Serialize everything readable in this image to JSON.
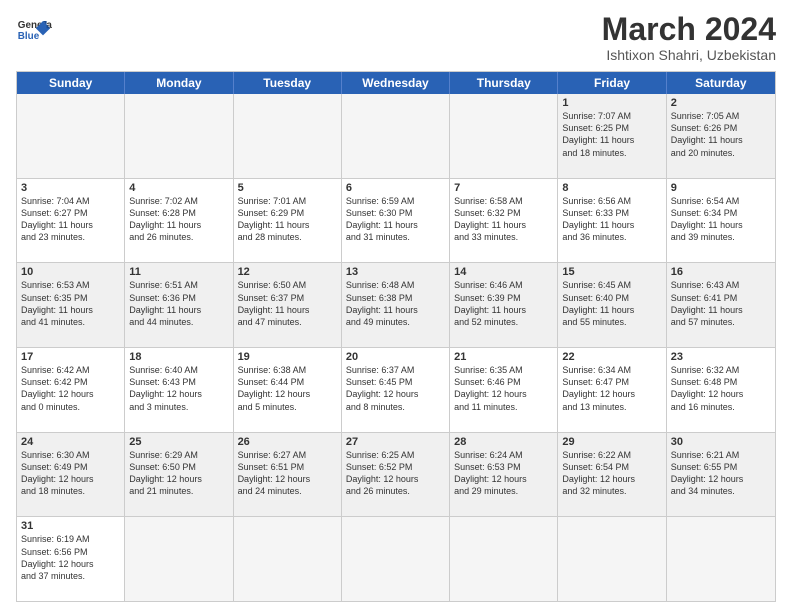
{
  "header": {
    "logo_general": "General",
    "logo_blue": "Blue",
    "month_title": "March 2024",
    "subtitle": "Ishtixon Shahri, Uzbekistan"
  },
  "weekdays": [
    "Sunday",
    "Monday",
    "Tuesday",
    "Wednesday",
    "Thursday",
    "Friday",
    "Saturday"
  ],
  "rows": [
    {
      "cells": [
        {
          "empty": true
        },
        {
          "empty": true
        },
        {
          "empty": true
        },
        {
          "empty": true
        },
        {
          "empty": true
        },
        {
          "day": "1",
          "lines": [
            "Sunrise: 7:07 AM",
            "Sunset: 6:25 PM",
            "Daylight: 11 hours",
            "and 18 minutes."
          ]
        },
        {
          "day": "2",
          "lines": [
            "Sunrise: 7:05 AM",
            "Sunset: 6:26 PM",
            "Daylight: 11 hours",
            "and 20 minutes."
          ]
        }
      ]
    },
    {
      "cells": [
        {
          "day": "3",
          "lines": [
            "Sunrise: 7:04 AM",
            "Sunset: 6:27 PM",
            "Daylight: 11 hours",
            "and 23 minutes."
          ]
        },
        {
          "day": "4",
          "lines": [
            "Sunrise: 7:02 AM",
            "Sunset: 6:28 PM",
            "Daylight: 11 hours",
            "and 26 minutes."
          ]
        },
        {
          "day": "5",
          "lines": [
            "Sunrise: 7:01 AM",
            "Sunset: 6:29 PM",
            "Daylight: 11 hours",
            "and 28 minutes."
          ]
        },
        {
          "day": "6",
          "lines": [
            "Sunrise: 6:59 AM",
            "Sunset: 6:30 PM",
            "Daylight: 11 hours",
            "and 31 minutes."
          ]
        },
        {
          "day": "7",
          "lines": [
            "Sunrise: 6:58 AM",
            "Sunset: 6:32 PM",
            "Daylight: 11 hours",
            "and 33 minutes."
          ]
        },
        {
          "day": "8",
          "lines": [
            "Sunrise: 6:56 AM",
            "Sunset: 6:33 PM",
            "Daylight: 11 hours",
            "and 36 minutes."
          ]
        },
        {
          "day": "9",
          "lines": [
            "Sunrise: 6:54 AM",
            "Sunset: 6:34 PM",
            "Daylight: 11 hours",
            "and 39 minutes."
          ]
        }
      ]
    },
    {
      "cells": [
        {
          "day": "10",
          "lines": [
            "Sunrise: 6:53 AM",
            "Sunset: 6:35 PM",
            "Daylight: 11 hours",
            "and 41 minutes."
          ]
        },
        {
          "day": "11",
          "lines": [
            "Sunrise: 6:51 AM",
            "Sunset: 6:36 PM",
            "Daylight: 11 hours",
            "and 44 minutes."
          ]
        },
        {
          "day": "12",
          "lines": [
            "Sunrise: 6:50 AM",
            "Sunset: 6:37 PM",
            "Daylight: 11 hours",
            "and 47 minutes."
          ]
        },
        {
          "day": "13",
          "lines": [
            "Sunrise: 6:48 AM",
            "Sunset: 6:38 PM",
            "Daylight: 11 hours",
            "and 49 minutes."
          ]
        },
        {
          "day": "14",
          "lines": [
            "Sunrise: 6:46 AM",
            "Sunset: 6:39 PM",
            "Daylight: 11 hours",
            "and 52 minutes."
          ]
        },
        {
          "day": "15",
          "lines": [
            "Sunrise: 6:45 AM",
            "Sunset: 6:40 PM",
            "Daylight: 11 hours",
            "and 55 minutes."
          ]
        },
        {
          "day": "16",
          "lines": [
            "Sunrise: 6:43 AM",
            "Sunset: 6:41 PM",
            "Daylight: 11 hours",
            "and 57 minutes."
          ]
        }
      ]
    },
    {
      "cells": [
        {
          "day": "17",
          "lines": [
            "Sunrise: 6:42 AM",
            "Sunset: 6:42 PM",
            "Daylight: 12 hours",
            "and 0 minutes."
          ]
        },
        {
          "day": "18",
          "lines": [
            "Sunrise: 6:40 AM",
            "Sunset: 6:43 PM",
            "Daylight: 12 hours",
            "and 3 minutes."
          ]
        },
        {
          "day": "19",
          "lines": [
            "Sunrise: 6:38 AM",
            "Sunset: 6:44 PM",
            "Daylight: 12 hours",
            "and 5 minutes."
          ]
        },
        {
          "day": "20",
          "lines": [
            "Sunrise: 6:37 AM",
            "Sunset: 6:45 PM",
            "Daylight: 12 hours",
            "and 8 minutes."
          ]
        },
        {
          "day": "21",
          "lines": [
            "Sunrise: 6:35 AM",
            "Sunset: 6:46 PM",
            "Daylight: 12 hours",
            "and 11 minutes."
          ]
        },
        {
          "day": "22",
          "lines": [
            "Sunrise: 6:34 AM",
            "Sunset: 6:47 PM",
            "Daylight: 12 hours",
            "and 13 minutes."
          ]
        },
        {
          "day": "23",
          "lines": [
            "Sunrise: 6:32 AM",
            "Sunset: 6:48 PM",
            "Daylight: 12 hours",
            "and 16 minutes."
          ]
        }
      ]
    },
    {
      "cells": [
        {
          "day": "24",
          "lines": [
            "Sunrise: 6:30 AM",
            "Sunset: 6:49 PM",
            "Daylight: 12 hours",
            "and 18 minutes."
          ]
        },
        {
          "day": "25",
          "lines": [
            "Sunrise: 6:29 AM",
            "Sunset: 6:50 PM",
            "Daylight: 12 hours",
            "and 21 minutes."
          ]
        },
        {
          "day": "26",
          "lines": [
            "Sunrise: 6:27 AM",
            "Sunset: 6:51 PM",
            "Daylight: 12 hours",
            "and 24 minutes."
          ]
        },
        {
          "day": "27",
          "lines": [
            "Sunrise: 6:25 AM",
            "Sunset: 6:52 PM",
            "Daylight: 12 hours",
            "and 26 minutes."
          ]
        },
        {
          "day": "28",
          "lines": [
            "Sunrise: 6:24 AM",
            "Sunset: 6:53 PM",
            "Daylight: 12 hours",
            "and 29 minutes."
          ]
        },
        {
          "day": "29",
          "lines": [
            "Sunrise: 6:22 AM",
            "Sunset: 6:54 PM",
            "Daylight: 12 hours",
            "and 32 minutes."
          ]
        },
        {
          "day": "30",
          "lines": [
            "Sunrise: 6:21 AM",
            "Sunset: 6:55 PM",
            "Daylight: 12 hours",
            "and 34 minutes."
          ]
        }
      ]
    },
    {
      "cells": [
        {
          "day": "31",
          "lines": [
            "Sunrise: 6:19 AM",
            "Sunset: 6:56 PM",
            "Daylight: 12 hours",
            "and 37 minutes."
          ]
        },
        {
          "empty": true
        },
        {
          "empty": true
        },
        {
          "empty": true
        },
        {
          "empty": true
        },
        {
          "empty": true
        },
        {
          "empty": true
        }
      ]
    }
  ]
}
